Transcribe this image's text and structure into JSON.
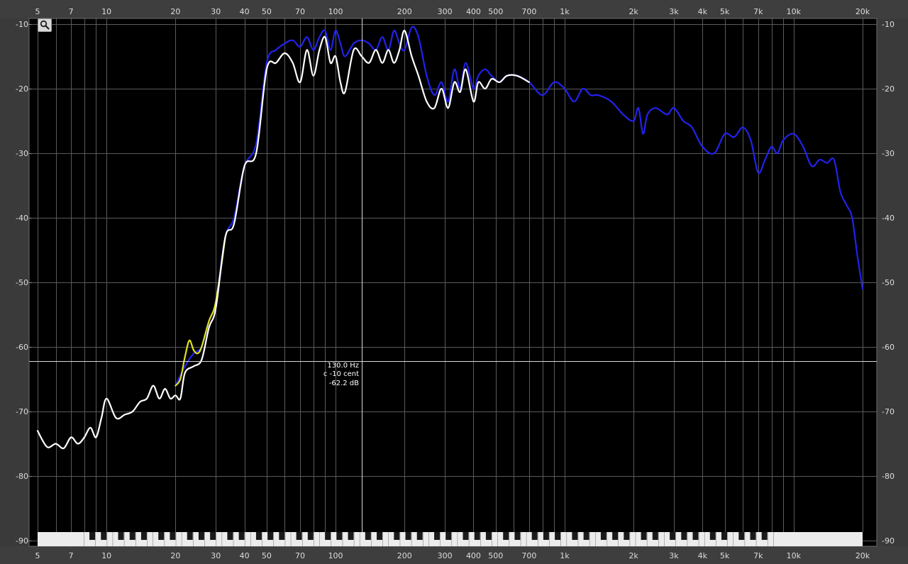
{
  "chart_data": {
    "type": "line",
    "title": "",
    "xlabel": "",
    "ylabel": "",
    "x_scale": "log",
    "xlim_hz": [
      5,
      20000
    ],
    "ylim_db": [
      -90,
      -10
    ],
    "grid": true,
    "x_tick_labels": [
      "5",
      "7",
      "10",
      "20",
      "30",
      "40",
      "50",
      "70",
      "100",
      "200",
      "300",
      "400",
      "500",
      "700",
      "1k",
      "2k",
      "3k",
      "4k",
      "5k",
      "7k",
      "10k",
      "20k"
    ],
    "x_tick_values_hz": [
      5,
      7,
      10,
      20,
      30,
      40,
      50,
      70,
      100,
      200,
      300,
      400,
      500,
      700,
      1000,
      2000,
      3000,
      4000,
      5000,
      7000,
      10000,
      20000
    ],
    "y_tick_labels": [
      "-10",
      "-20",
      "-30",
      "-40",
      "-50",
      "-60",
      "-70",
      "-80",
      "-90"
    ],
    "y_tick_values_db": [
      -10,
      -20,
      -30,
      -40,
      -50,
      -60,
      -70,
      -80,
      -90
    ],
    "series": [
      {
        "color": "#2222ee",
        "x": [
          20,
          22,
          24,
          26,
          28,
          30,
          33,
          36,
          40,
          45,
          50,
          55,
          60,
          65,
          70,
          75,
          80,
          85,
          90,
          95,
          100,
          105,
          110,
          120,
          130,
          140,
          150,
          160,
          170,
          180,
          190,
          200,
          215,
          230,
          250,
          270,
          290,
          310,
          330,
          350,
          370,
          400,
          420,
          450,
          480,
          520,
          560,
          620,
          700,
          800,
          900,
          1000,
          1100,
          1200,
          1300,
          1400,
          1600,
          1800,
          2000,
          2100,
          2200,
          2300,
          2500,
          2800,
          3000,
          3300,
          3600,
          4000,
          4500,
          5000,
          5500,
          6000,
          6500,
          7000,
          7500,
          8000,
          8500,
          9000,
          10000,
          11000,
          12000,
          13000,
          14000,
          15000,
          16000,
          17000,
          18000,
          19000,
          20000
        ],
        "y": [
          -66,
          -63,
          -61,
          -60,
          -56,
          -53,
          -43,
          -40,
          -32,
          -28.5,
          -16,
          -14,
          -13,
          -12.5,
          -13.5,
          -12,
          -14,
          -12,
          -11,
          -14,
          -11,
          -13,
          -15,
          -13,
          -12.5,
          -13,
          -14,
          -12,
          -14,
          -11,
          -13,
          -14,
          -10.5,
          -12,
          -18,
          -21,
          -19,
          -22,
          -17,
          -20,
          -16,
          -20,
          -18,
          -17,
          -18,
          -19,
          -18,
          -18,
          -19,
          -21,
          -19,
          -20,
          -22,
          -20,
          -21,
          -21,
          -22,
          -24,
          -25,
          -23,
          -27,
          -24,
          -23,
          -24,
          -23,
          -25,
          -26,
          -29,
          -30,
          -27,
          -27.5,
          -26,
          -28,
          -33,
          -31,
          -29,
          -30,
          -28,
          -27,
          -29,
          -32,
          -31,
          -31.5,
          -31,
          -36,
          -38,
          -40,
          -46,
          -51
        ]
      },
      {
        "color": "#e0e020",
        "x": [
          20,
          21,
          22,
          23,
          24,
          25,
          26,
          28,
          30,
          33
        ],
        "y": [
          -66,
          -65,
          -61.5,
          -59,
          -60.5,
          -61,
          -60,
          -56,
          -53,
          -43
        ]
      },
      {
        "color": "#ffffff",
        "x": [
          5,
          5.5,
          6,
          6.5,
          7,
          7.5,
          8,
          8.5,
          9,
          9.5,
          10,
          11,
          12,
          13,
          14,
          15,
          16,
          17,
          18,
          19,
          20,
          21,
          22,
          24,
          26,
          28,
          30,
          33,
          36,
          40,
          45,
          50,
          55,
          60,
          65,
          70,
          75,
          80,
          85,
          90,
          95,
          100,
          105,
          110,
          120,
          130,
          140,
          150,
          160,
          170,
          180,
          190,
          200,
          215,
          230,
          250,
          270,
          290,
          310,
          330,
          350,
          370,
          400,
          420,
          450,
          480,
          520,
          560,
          620,
          700
        ],
        "y": [
          -73,
          -75.5,
          -75,
          -75.7,
          -74,
          -75,
          -74,
          -72.5,
          -74,
          -71,
          -68,
          -71,
          -70.5,
          -70,
          -68.5,
          -68,
          -66,
          -68,
          -66.5,
          -68,
          -67.5,
          -68,
          -64,
          -63,
          -62,
          -57,
          -54,
          -43,
          -41,
          -32,
          -30,
          -17,
          -16,
          -14.5,
          -16,
          -19,
          -14,
          -18,
          -14,
          -12,
          -16,
          -15,
          -19,
          -20.5,
          -14,
          -15,
          -16,
          -14,
          -16,
          -14,
          -16,
          -14,
          -11,
          -15,
          -18,
          -22,
          -23,
          -20,
          -23,
          -19,
          -20.5,
          -17,
          -22,
          -19,
          -20,
          -18.5,
          -19,
          -18,
          -18,
          -19
        ]
      }
    ],
    "cursor": {
      "x_hz": 130,
      "y_db": -62.2,
      "readout_line1": "130.0 Hz",
      "readout_line2": "c -10 cent",
      "readout_line3": "-62.2 dB"
    }
  },
  "toolbar": {
    "zoom_icon": "magnifier-icon"
  },
  "keyboard": {
    "icon": "piano-keyboard"
  }
}
